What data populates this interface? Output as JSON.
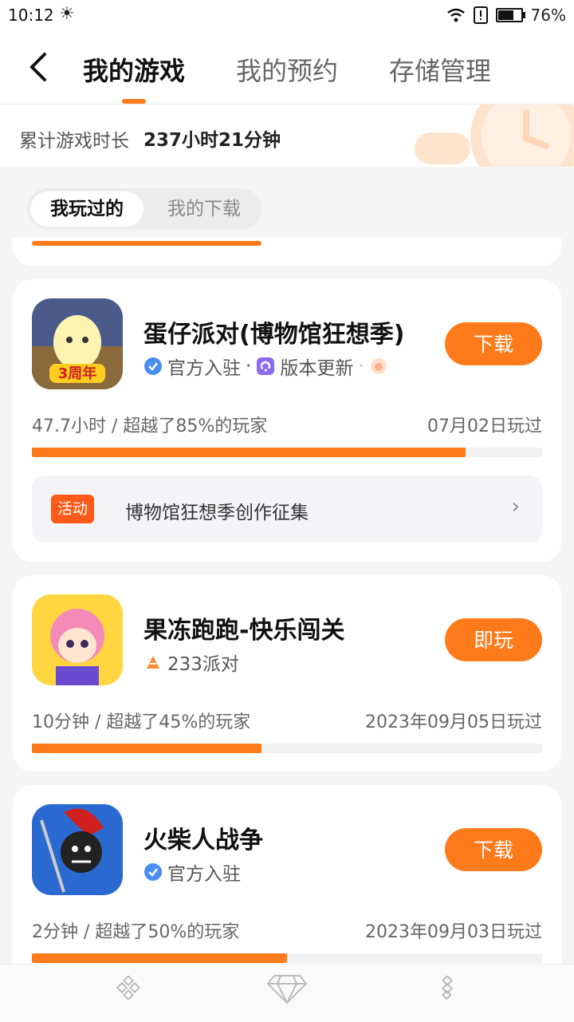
{
  "status_bar": {
    "time": "10:12",
    "battery": "76%",
    "battery_level": 0.76,
    "icons": [
      "sun-icon",
      "wifi-icon",
      "alert-icon",
      "battery-icon"
    ]
  },
  "header": {
    "tabs": [
      {
        "label": "我的游戏"
      },
      {
        "label": "我的预约"
      },
      {
        "label": "存储管理"
      }
    ],
    "active_tab": 0
  },
  "summary": {
    "label": "累计游戏时长",
    "value": "237小时21分钟"
  },
  "subtabs": [
    {
      "label": "我玩过的"
    },
    {
      "label": "我的下载"
    }
  ],
  "accent_color": "#ff7a1a",
  "games": [
    {
      "title": "蛋仔派对(博物馆狂想季)",
      "tags": [
        "官方入驻",
        "版本更新"
      ],
      "button": "下载",
      "stat": "47.7小时 / 超越了85%的玩家",
      "date": "07月02日玩过",
      "progress": 0.85,
      "activity": {
        "badge": "活动",
        "text": "博物馆狂想季创作征集"
      },
      "icon": "game-icon-eggy-party"
    },
    {
      "title": "果冻跑跑-快乐闯关",
      "tags": [
        "233派对"
      ],
      "button": "即玩",
      "stat": "10分钟 / 超越了45%的玩家",
      "date": "2023年09月05日玩过",
      "progress": 0.45,
      "icon": "game-icon-jelly-run"
    },
    {
      "title": "火柴人战争",
      "tags": [
        "官方入驻"
      ],
      "button": "下载",
      "stat": "2分钟 / 超越了50%的玩家",
      "date": "2023年09月03日玩过",
      "progress": 0.5,
      "icon": "game-icon-stick-war"
    }
  ],
  "bottom_nav": [
    "diamond-grid-icon",
    "gem-icon",
    "diamond-grid-icon"
  ]
}
